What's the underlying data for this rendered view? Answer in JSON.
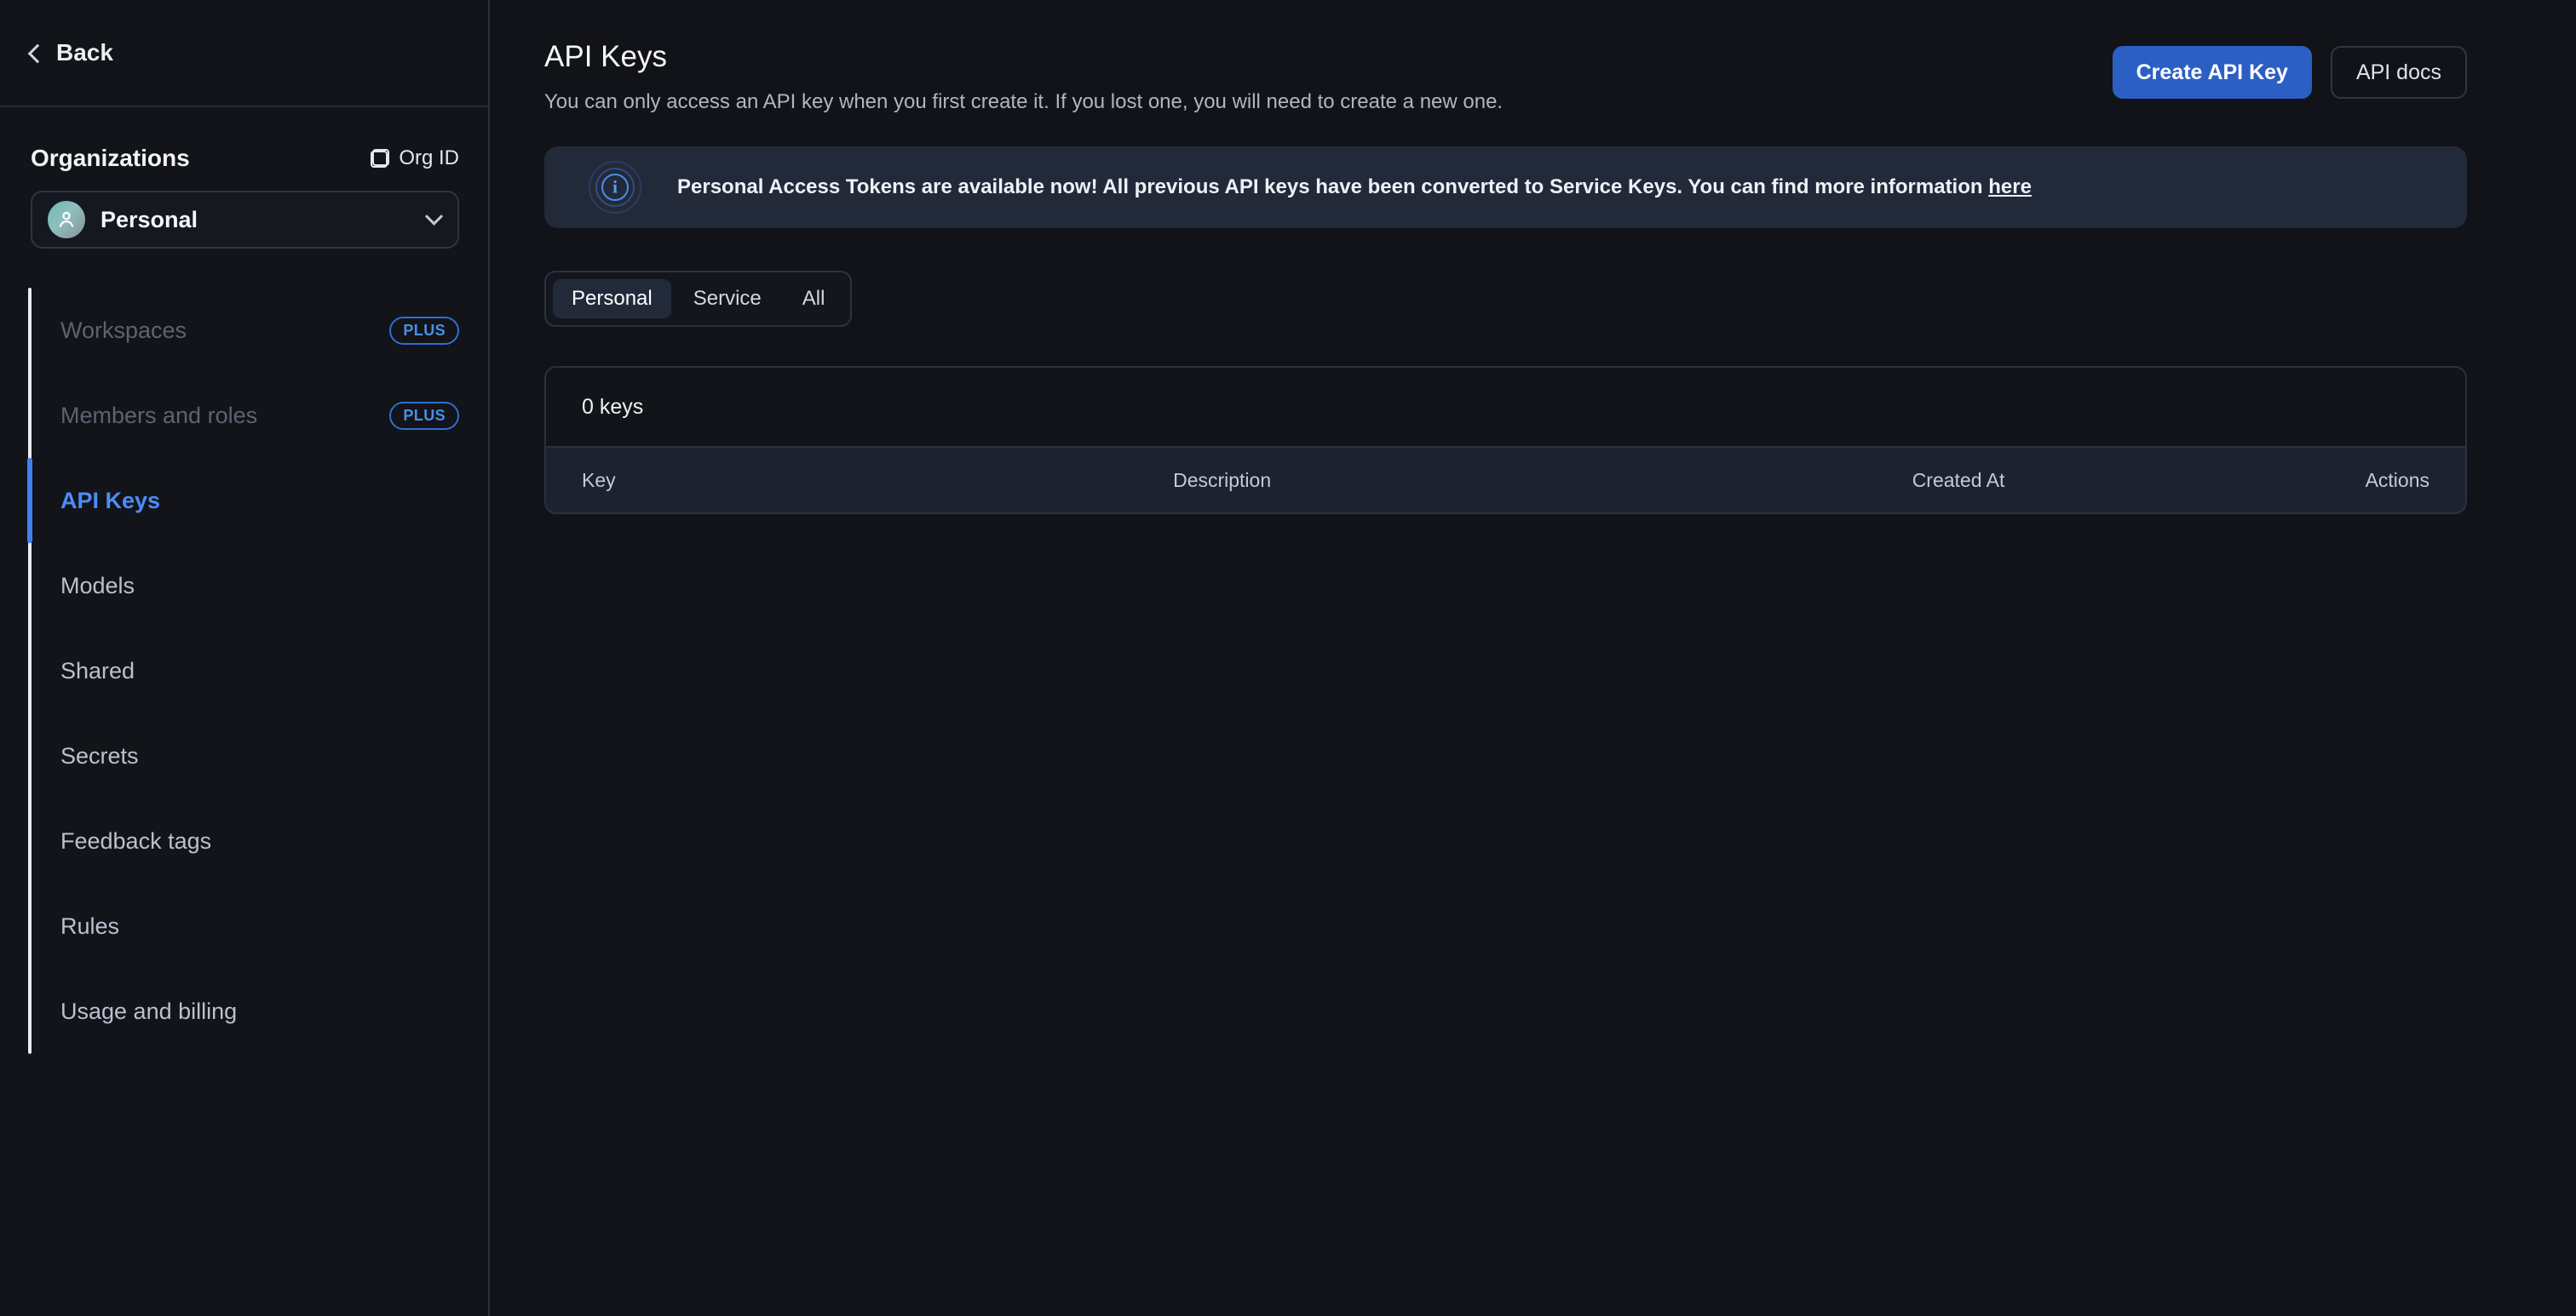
{
  "sidebar": {
    "back_label": "Back",
    "organizations_label": "Organizations",
    "org_id_label": "Org ID",
    "selected_org": "Personal",
    "nav_items": [
      {
        "label": "Workspaces",
        "badge": "PLUS",
        "state": "disabled"
      },
      {
        "label": "Members and roles",
        "badge": "PLUS",
        "state": "disabled"
      },
      {
        "label": "API Keys",
        "badge": "",
        "state": "active"
      },
      {
        "label": "Models",
        "badge": "",
        "state": "default"
      },
      {
        "label": "Shared",
        "badge": "",
        "state": "default"
      },
      {
        "label": "Secrets",
        "badge": "",
        "state": "default"
      },
      {
        "label": "Feedback tags",
        "badge": "",
        "state": "default"
      },
      {
        "label": "Rules",
        "badge": "",
        "state": "default"
      },
      {
        "label": "Usage and billing",
        "badge": "",
        "state": "default"
      }
    ]
  },
  "header": {
    "title": "API Keys",
    "subtitle": "You can only access an API key when you first create it. If you lost one, you will need to create a new one.",
    "create_button": "Create API Key",
    "docs_button": "API docs"
  },
  "banner": {
    "text_before_link": "Personal Access Tokens are available now! All previous API keys have been converted to Service Keys. You can find more information ",
    "link_text": "here"
  },
  "tabs": [
    {
      "label": "Personal",
      "active": true
    },
    {
      "label": "Service",
      "active": false
    },
    {
      "label": "All",
      "active": false
    }
  ],
  "table": {
    "summary": "0 keys",
    "columns": [
      "Key",
      "Description",
      "Created At",
      "Actions"
    ],
    "rows": []
  },
  "colors": {
    "accent_blue": "#4c8cf6",
    "primary_button": "#2c5fc4",
    "banner_bg": "#222a3a",
    "page_bg": "#111318",
    "sidebar_bg": "#121419"
  }
}
